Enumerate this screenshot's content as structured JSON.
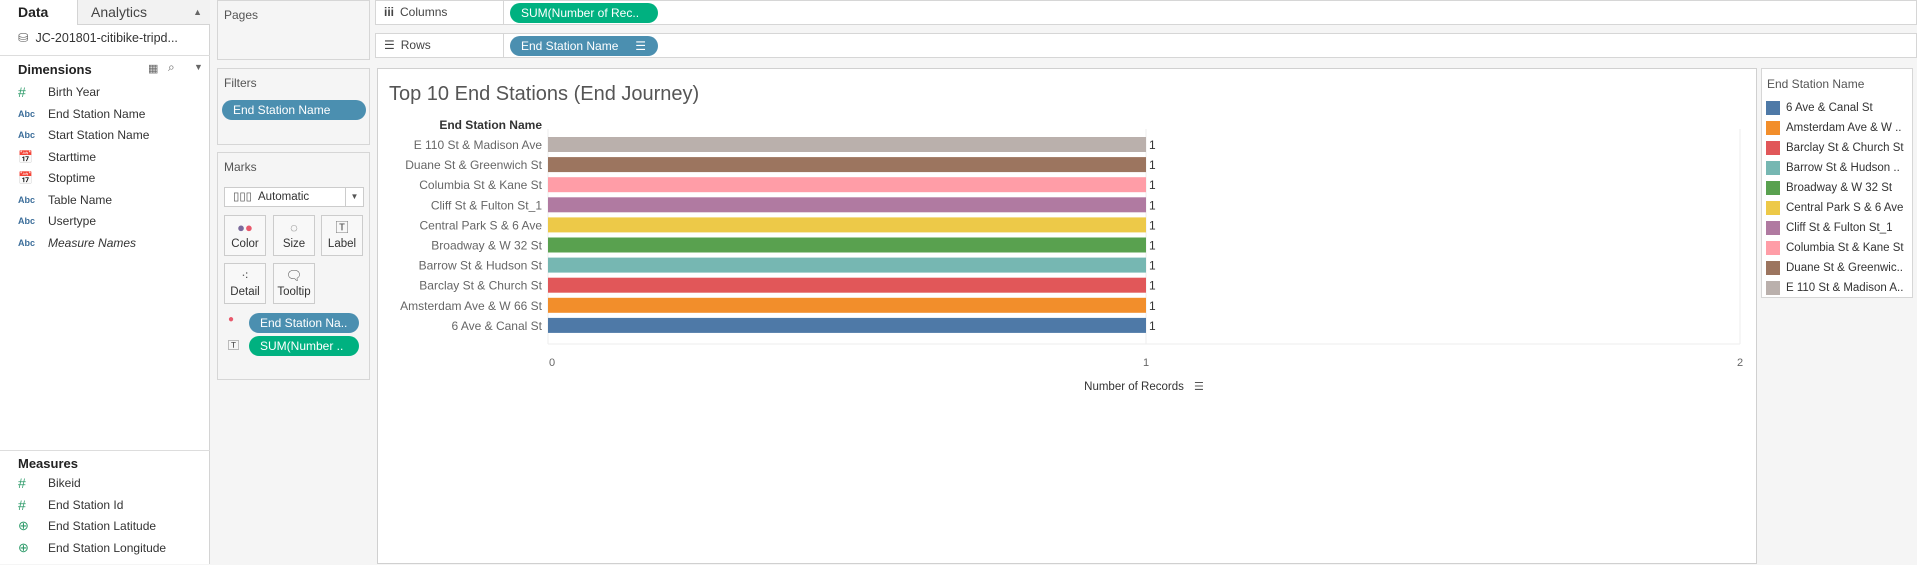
{
  "left_panel": {
    "tabs": {
      "data": "Data",
      "analytics": "Analytics"
    },
    "datasource": "JC-201801-citibike-tripd...",
    "dimensions_title": "Dimensions",
    "dimensions": [
      {
        "label": "Birth Year",
        "type": "number"
      },
      {
        "label": "End Station Name",
        "type": "string"
      },
      {
        "label": "Start Station Name",
        "type": "string"
      },
      {
        "label": "Starttime",
        "type": "datetime"
      },
      {
        "label": "Stoptime",
        "type": "datetime"
      },
      {
        "label": "Table Name",
        "type": "string"
      },
      {
        "label": "Usertype",
        "type": "string"
      },
      {
        "label": "Measure Names",
        "type": "string"
      }
    ],
    "measures_title": "Measures",
    "measures": [
      {
        "label": "Bikeid",
        "type": "number"
      },
      {
        "label": "End Station Id",
        "type": "number"
      },
      {
        "label": "End Station Latitude",
        "type": "geo"
      },
      {
        "label": "End Station Longitude",
        "type": "geo"
      }
    ],
    "type_icons": {
      "number": "#",
      "string": "Abc",
      "datetime": "📅",
      "geo": "⊕"
    }
  },
  "pages": {
    "title": "Pages"
  },
  "filters": {
    "title": "Filters",
    "pills": [
      "End Station Name"
    ]
  },
  "marks": {
    "title": "Marks",
    "type": "Automatic",
    "buttons": [
      "Color",
      "Size",
      "Label",
      "Detail",
      "Tooltip"
    ],
    "pills": [
      "End Station Na..",
      "SUM(Number .."
    ]
  },
  "shelves": {
    "columns_label": "Columns",
    "columns_pill": "SUM(Number of Rec..",
    "rows_label": "Rows",
    "rows_pill": "End Station Name"
  },
  "colors": {
    "pill_dimension": "#4b8fb0",
    "pill_measure": "#00b180"
  },
  "chart_data": {
    "type": "bar",
    "orientation": "horizontal",
    "title": "Top 10 End Stations (End Journey)",
    "ylabel": "End Station Name",
    "xlabel": "Number of Records",
    "xlim": [
      0,
      2
    ],
    "xticks": [
      "0",
      "1",
      "2"
    ],
    "categories": [
      "E 110 St & Madison Ave",
      "Duane St & Greenwich St",
      "Columbia St & Kane St",
      "Cliff St & Fulton St_1",
      "Central Park S & 6 Ave",
      "Broadway & W 32 St",
      "Barrow St & Hudson St",
      "Barclay St & Church St",
      "Amsterdam Ave & W 66 St",
      "6 Ave & Canal St"
    ],
    "values": [
      1,
      1,
      1,
      1,
      1,
      1,
      1,
      1,
      1,
      1
    ],
    "colors": [
      "#bab0ac",
      "#9c755f",
      "#ff9da7",
      "#b07aa1",
      "#edc948",
      "#59a14f",
      "#76b7b2",
      "#e15759",
      "#f28e2b",
      "#4e79a7"
    ],
    "data_labels": [
      "1",
      "1",
      "1",
      "1",
      "1",
      "1",
      "1",
      "1",
      "1",
      "1"
    ]
  },
  "legend": {
    "title": "End Station Name",
    "items": [
      {
        "label": "6 Ave & Canal St",
        "color": "#4e79a7"
      },
      {
        "label": "Amsterdam Ave & W ..",
        "color": "#f28e2b"
      },
      {
        "label": "Barclay St & Church St",
        "color": "#e15759"
      },
      {
        "label": "Barrow St & Hudson ..",
        "color": "#76b7b2"
      },
      {
        "label": "Broadway & W 32 St",
        "color": "#59a14f"
      },
      {
        "label": "Central Park S & 6 Ave",
        "color": "#edc948"
      },
      {
        "label": "Cliff St & Fulton St_1",
        "color": "#b07aa1"
      },
      {
        "label": "Columbia St & Kane St",
        "color": "#ff9da7"
      },
      {
        "label": "Duane St & Greenwic..",
        "color": "#9c755f"
      },
      {
        "label": "E 110 St & Madison A..",
        "color": "#bab0ac"
      }
    ]
  }
}
